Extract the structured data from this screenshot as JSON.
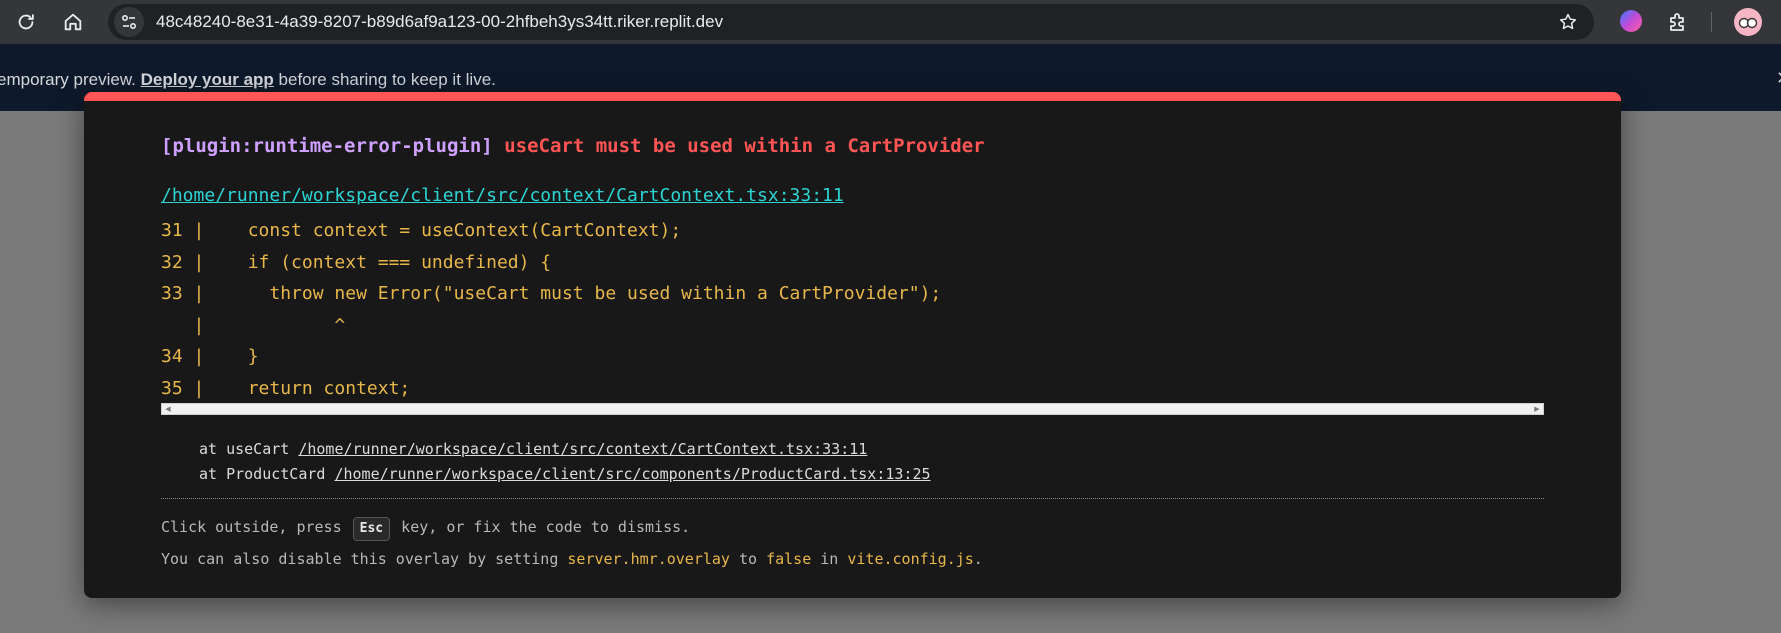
{
  "browser": {
    "url": "48c48240-8e31-4a39-8207-b89d6af9a123-00-2hfbeh3ys34tt.riker.replit.dev",
    "icons": [
      "reload-icon",
      "home-icon",
      "site-info-icon",
      "bookmark-star-icon",
      "extension-brain-icon",
      "extensions-puzzle-icon",
      "profile-avatar-icon"
    ]
  },
  "banner": {
    "text_before": "emporary preview. ",
    "link": "Deploy your app",
    "text_after": " before sharing to keep it live.",
    "close": "✕"
  },
  "overlay": {
    "plugin": "[plugin:runtime-error-plugin]",
    "message": "useCart must be used within a CartProvider",
    "file": "/home/runner/workspace/client/src/context/CartContext.tsx:33:11",
    "code_lines": [
      "31 |    const context = useContext(CartContext);",
      "32 |    if (context === undefined) {",
      "33 |      throw new Error(\"useCart must be used within a CartProvider\");",
      "   |            ^",
      "34 |    }",
      "35 |    return context;"
    ],
    "stack": [
      {
        "prefix": "at useCart ",
        "location": "/home/runner/workspace/client/src/context/CartContext.tsx:33:11"
      },
      {
        "prefix": "at ProductCard ",
        "location": "/home/runner/workspace/client/src/components/ProductCard.tsx:13:25"
      }
    ],
    "tip1": {
      "before": "Click outside, press ",
      "key": "Esc",
      "after": " key, or fix the code to dismiss."
    },
    "tip2": {
      "before": "You can also disable this overlay by setting ",
      "setting": "server.hmr.overlay",
      "mid1": " to ",
      "value": "false",
      "mid2": " in ",
      "file": "vite.config.js",
      "end": "."
    },
    "colors": {
      "accent_red": "#ff5555",
      "plugin_purple": "#cfa0ff",
      "link_cyan": "#2dd4d4",
      "code_yellow": "#e8b74a"
    }
  }
}
